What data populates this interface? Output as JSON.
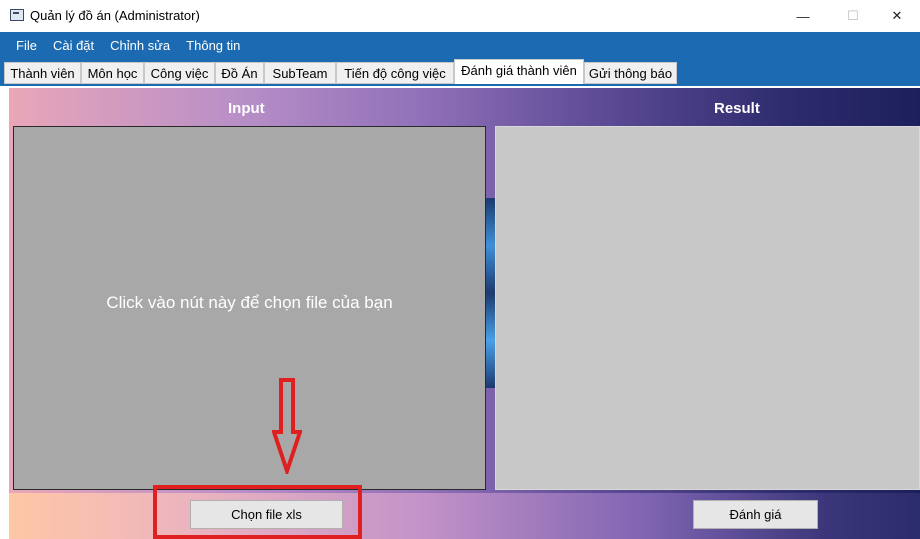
{
  "window": {
    "title": "Quản lý đồ án (Administrator)",
    "minimize_glyph": "—",
    "maximize_glyph": "☐",
    "close_glyph": "✕",
    "icon": "app-window-icon"
  },
  "menu": [
    "File",
    "Cài đặt",
    "Chỉnh sửa",
    "Thông tin"
  ],
  "tabs": [
    "Thành viên",
    "Môn học",
    "Công việc",
    "Đồ Án",
    "SubTeam",
    "Tiến độ công việc",
    "Đánh giá thành viên",
    "Gửi thông báo"
  ],
  "active_tab": "Đánh giá thành viên",
  "input": {
    "header": "Input",
    "hint": "Click vào nút này để chọn file của bạn",
    "button": "Chọn file xls"
  },
  "result": {
    "header": "Result",
    "button": "Đánh giá"
  },
  "annotation": {
    "arrow_icon": "down-arrow-icon",
    "color": "#e02020"
  },
  "colors": {
    "menu_bar": "#1c6bb2",
    "input_panel": "#a8a8a8",
    "result_panel": "#c8c8c8"
  }
}
